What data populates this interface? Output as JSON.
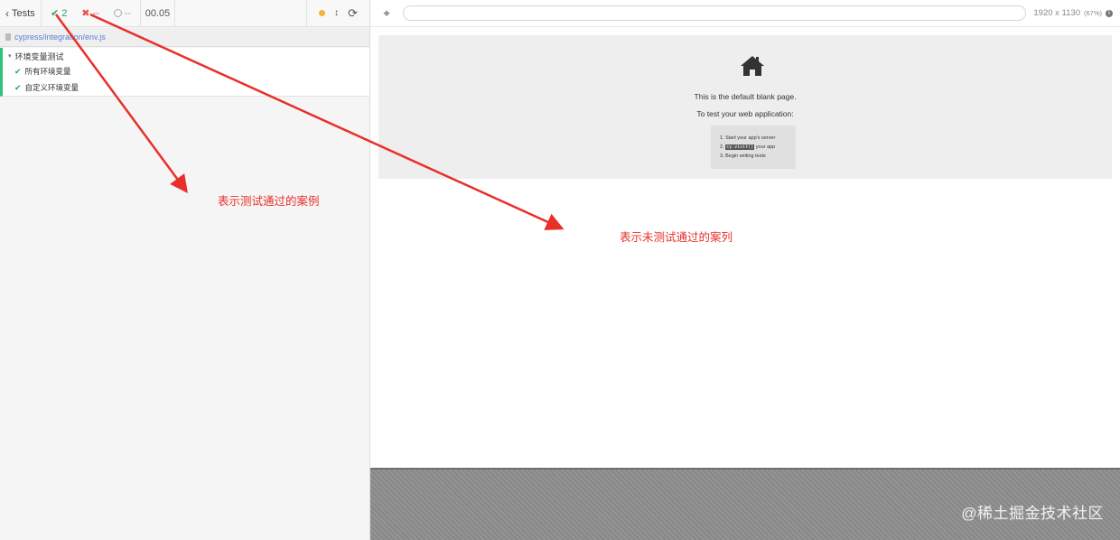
{
  "reporter": {
    "back_label": "Tests",
    "passed_count": "2",
    "failed_count": "--",
    "pending_count": "--",
    "duration": "00.05",
    "spec_path": "cypress/integration/env.js",
    "suite_title": "环境变量测试",
    "tests": [
      {
        "title": "所有环境变量",
        "state": "passed"
      },
      {
        "title": "自定义环境变量",
        "state": "passed"
      }
    ]
  },
  "aut": {
    "url": "",
    "viewport_size": "1920 x 1130",
    "viewport_scale": "(67%)",
    "blank_page": {
      "line1": "This is the default blank page.",
      "line2": "To test your web application:",
      "step1": "1. Start your app's server",
      "step2_prefix": "2.",
      "step2_code": "cy.visit()",
      "step2_suffix": "your app",
      "step3": "3. Begin writing tests"
    }
  },
  "annotations": {
    "passed": "表示测试通过的案例",
    "failed": "表示未测试通过的案列"
  },
  "watermark": "@稀土掘金技术社区",
  "colors": {
    "pass": "#2aa567",
    "fail": "#e94f4f",
    "annotation": "#e8302a",
    "accent_bar": "#2ec47b"
  },
  "icons": {
    "back": "chevron-left-icon",
    "passed": "check-icon",
    "failed": "x-icon",
    "pending": "circle-icon",
    "selector": "crosshair-icon",
    "home": "house-icon"
  }
}
